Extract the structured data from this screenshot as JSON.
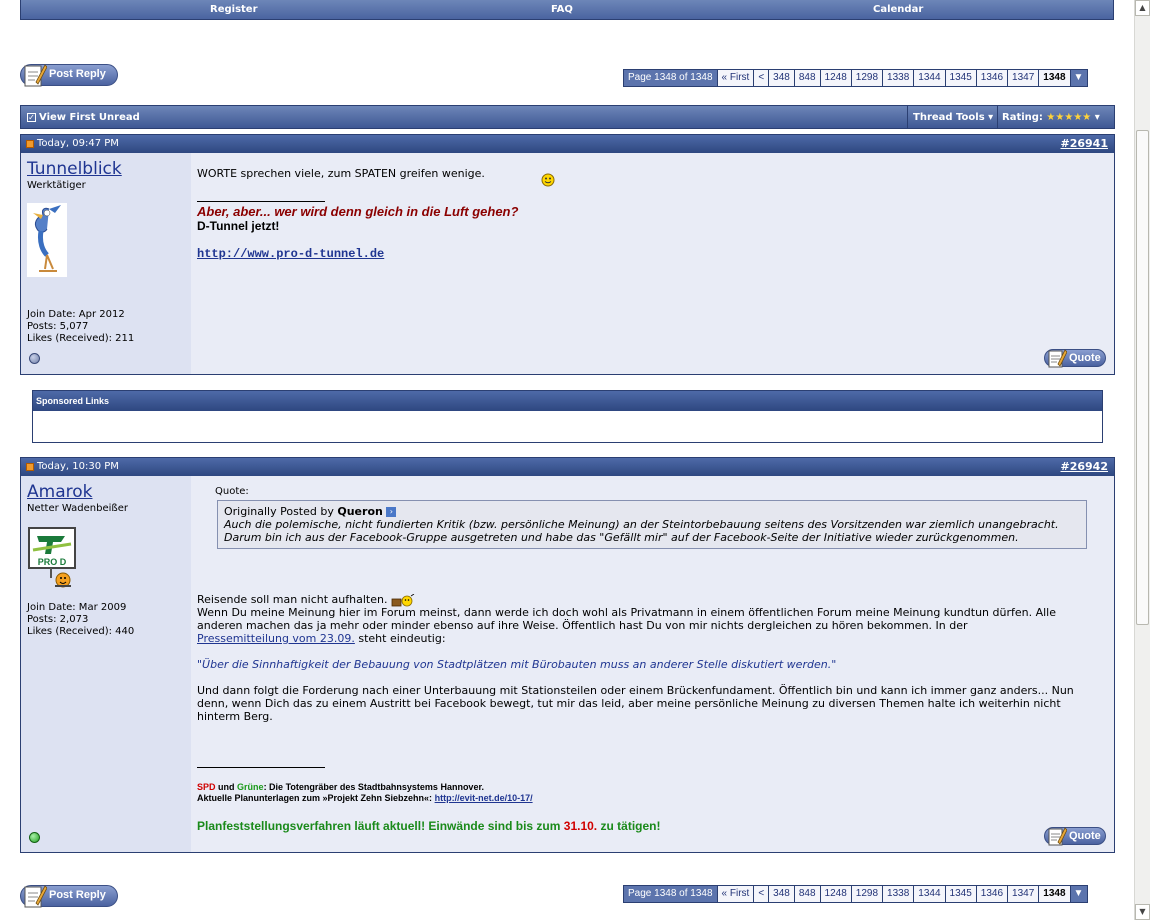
{
  "topnav": {
    "register": "Register",
    "faq": "FAQ",
    "calendar": "Calendar"
  },
  "post_reply": "Post Reply",
  "pagination": {
    "info": "Page 1348 of 1348",
    "first": "« First",
    "prev": "<",
    "pages": [
      "348",
      "848",
      "1248",
      "1298",
      "1338",
      "1344",
      "1345",
      "1346",
      "1347"
    ],
    "current": "1348"
  },
  "threadbar": {
    "view_first_unread": "View First Unread",
    "thread_tools": "Thread Tools",
    "rating": "Rating:",
    "rating_stars": "★★★★★"
  },
  "post1": {
    "date": "Today, 09:47 PM",
    "number": "#26941",
    "username": "Tunnelblick",
    "user_title": "Werktätiger",
    "join_date": "Join Date: Apr 2012",
    "posts": "Posts: 5,077",
    "likes": "Likes (Received): 211",
    "message": "WORTE sprechen viele, zum SPATEN greifen wenige.",
    "sig_line1": "Aber, aber... wer wird denn gleich in die Luft gehen?",
    "sig_line2": "D-Tunnel jetzt!",
    "sig_link": "http://www.pro-d-tunnel.de",
    "quote": "Quote",
    "online_color": "#7080a8"
  },
  "sponsored": {
    "title": "Sponsored Links"
  },
  "post2": {
    "date": "Today, 10:30 PM",
    "number": "#26942",
    "username": "Amarok",
    "user_title": "Netter Wadenbeißer",
    "avatar_text": "PRO D",
    "join_date": "Join Date: Mar 2009",
    "posts": "Posts: 2,073",
    "likes": "Likes (Received): 440",
    "quote_label": "Quote:",
    "quote_originally": "Originally Posted by",
    "quote_author": "Queron",
    "quote_text": "Auch die polemische, nicht fundierten Kritik (bzw. persönliche Meinung) an der Steintorbebauung seitens des Vorsitzenden war ziemlich unangebracht. Darum bin ich aus der Facebook-Gruppe ausgetreten und habe das \"Gefällt mir\" auf der Facebook-Seite der Initiative wieder zurückgenommen.",
    "p1": "Reisende soll man nicht aufhalten.",
    "p2a": "Wenn Du meine Meinung hier im Forum meinst, dann werde ich doch wohl als Privatmann in einem öffentlichen Forum meine Meinung kundtun dürfen. Alle anderen machen das ja mehr oder minder ebenso auf ihre Weise. Öffentlich hast Du von mir nichts dergleichen zu hören bekommen. In der",
    "p2_link": "Pressemitteilung vom 23.09.",
    "p2b": "steht eindeutig:",
    "p3": "\"Über die Sinnhaftigkeit der Bebauung von Stadtplätzen mit Bürobauten muss an anderer Stelle diskutiert werden.\"",
    "p4": "Und dann folgt die Forderung nach einer Unterbauung mit Stationsteilen oder einem Brückenfundament. Öffentlich bin und kann ich immer ganz anders... Nun denn, wenn Dich das zu einem Austritt bei Facebook bewegt, tut mir das leid, aber meine persönliche Meinung zu diversen Themen halte ich weiterhin nicht hinterm Berg.",
    "sig_spd": "SPD",
    "sig_und": "und",
    "sig_gruene": "Grüne",
    "sig_rest1": ": Die Totengräber des Stadtbahnsystems Hannover.",
    "sig_rest2": "Aktuelle Planunterlagen zum »Projekt Zehn Siebzehn«:",
    "sig_link2": "http://evit-net.de/10-17/",
    "sig_green1": "Planfeststellungsverfahren läuft aktuell! Einwände sind bis zum",
    "sig_red_date": "31.10.",
    "sig_green2": "zu tätigen!",
    "quote": "Quote",
    "online_color": "#22a022"
  },
  "colors": {
    "header_blue": "#3f5894",
    "link_blue": "#1f3591",
    "post_bg": "#e9ecf6",
    "user_bg": "#dde2f2"
  }
}
